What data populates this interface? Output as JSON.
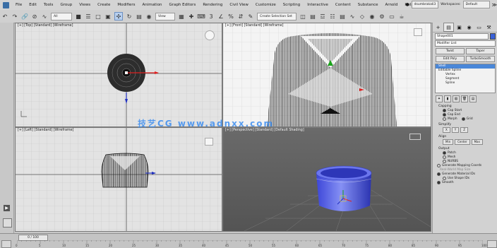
{
  "menubar": {
    "items": [
      "File",
      "Edit",
      "Tools",
      "Group",
      "Views",
      "Create",
      "Modifiers",
      "Animation",
      "Graph Editors",
      "Rendering",
      "Civil View",
      "Customize",
      "Scripting",
      "Interactive",
      "Content",
      "Substance",
      "Arnold",
      "Help"
    ],
    "user": "dsumbrakali3",
    "workspace_label": "Workspaces:",
    "workspace_value": "Default"
  },
  "toolbar": {
    "filter_value": "All",
    "view_value": "View",
    "selection_set": "Create Selection Set"
  },
  "viewports": {
    "top": {
      "label": "[+] [Top] [Standard] [Wireframe]"
    },
    "front": {
      "label": "[+] [Front] [Standard] [Wireframe]"
    },
    "left": {
      "label": "[+] [Left] [Standard] [Wireframe]"
    },
    "persp": {
      "label": "[+] [Perspective] [Standard] [Default Shading]"
    }
  },
  "watermark": "技艺CG  www.adnxx.com",
  "command_panel": {
    "object_name": "Shape001",
    "modifier_list": "Modifier List",
    "buttons": [
      "Twist",
      "Taper",
      "Edit Poly",
      "TurboSmooth"
    ],
    "stack": [
      {
        "label": "Shell",
        "sel": true,
        "level": 0
      },
      {
        "label": "Editable Spline",
        "sel": false,
        "level": 0
      },
      {
        "label": "Vertex",
        "sel": false,
        "level": 1
      },
      {
        "label": "Segment",
        "sel": false,
        "level": 1
      },
      {
        "label": "Spline",
        "sel": false,
        "level": 1
      }
    ],
    "capping_title": "Capping",
    "cap_start": "Cap Start",
    "cap_end": "Cap End",
    "morph": "Morph",
    "grid": "Grid",
    "simplify_title": "Simplify",
    "align_title": "Align",
    "align_buttons": [
      "Min",
      "Center",
      "Max"
    ],
    "output_title": "Output",
    "output_options": [
      "Patch",
      "Mesh",
      "NURBS"
    ],
    "mapping": "Generate Mapping Coords",
    "realworld": "Real-World Map Size",
    "generate": "Generate Material IDs",
    "use_shape": "Use Shape IDs",
    "smooth": "Smooth"
  },
  "timeline": {
    "frame": "0 / 100",
    "ticks": [
      "0",
      "5",
      "10",
      "15",
      "20",
      "25",
      "30",
      "35",
      "40",
      "45",
      "50",
      "55",
      "60",
      "65",
      "70",
      "75",
      "80",
      "85",
      "90",
      "95",
      "100"
    ]
  }
}
